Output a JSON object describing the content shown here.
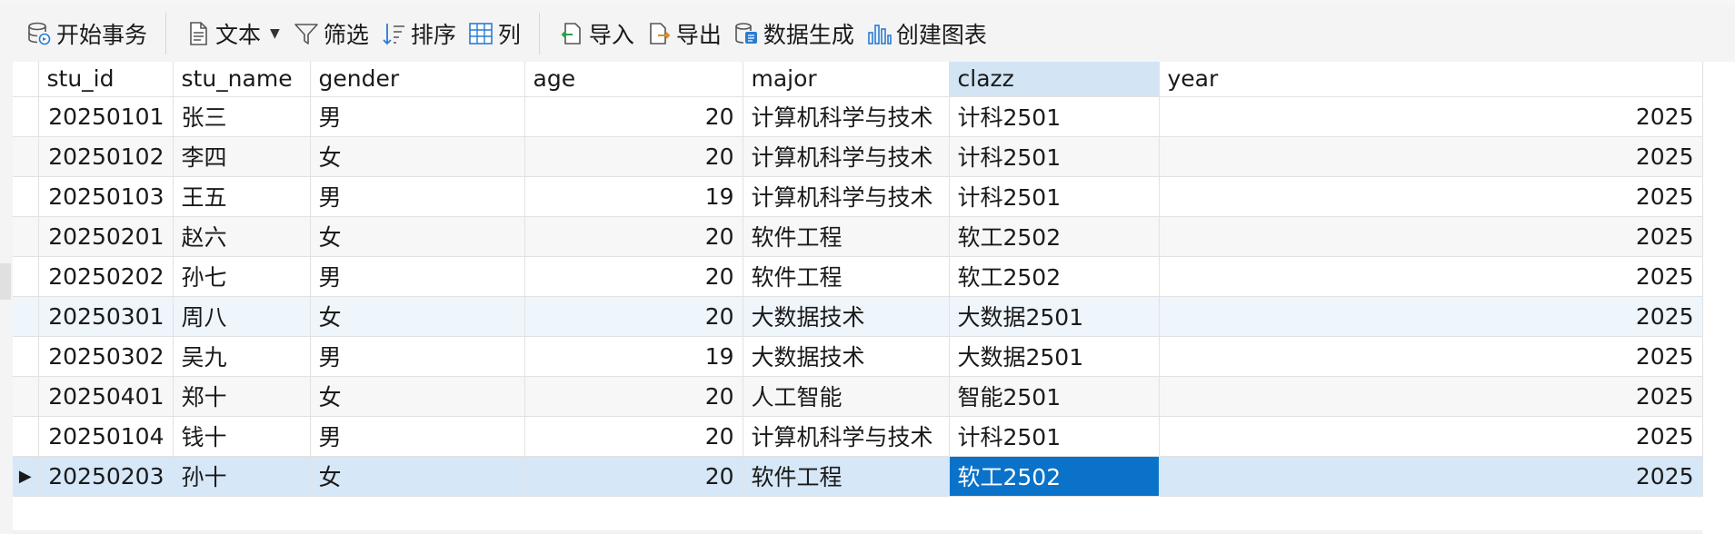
{
  "toolbar": {
    "begin_transaction": "开始事务",
    "text": "文本",
    "filter": "筛选",
    "sort": "排序",
    "columns": "列",
    "import": "导入",
    "export": "导出",
    "data_generate": "数据生成",
    "create_chart": "创建图表"
  },
  "table": {
    "headers": [
      "stu_id",
      "stu_name",
      "gender",
      "age",
      "major",
      "clazz",
      "year"
    ],
    "rows": [
      [
        "20250101",
        "张三",
        "男",
        "20",
        "计算机科学与技术",
        "计科2501",
        "2025"
      ],
      [
        "20250102",
        "李四",
        "女",
        "20",
        "计算机科学与技术",
        "计科2501",
        "2025"
      ],
      [
        "20250103",
        "王五",
        "男",
        "19",
        "计算机科学与技术",
        "计科2501",
        "2025"
      ],
      [
        "20250201",
        "赵六",
        "女",
        "20",
        "软件工程",
        "软工2502",
        "2025"
      ],
      [
        "20250202",
        "孙七",
        "男",
        "20",
        "软件工程",
        "软工2502",
        "2025"
      ],
      [
        "20250301",
        "周八",
        "女",
        "20",
        "大数据技术",
        "大数据2501",
        "2025"
      ],
      [
        "20250302",
        "吴九",
        "男",
        "19",
        "大数据技术",
        "大数据2501",
        "2025"
      ],
      [
        "20250401",
        "郑十",
        "女",
        "20",
        "人工智能",
        "智能2501",
        "2025"
      ],
      [
        "20250104",
        "钱十",
        "男",
        "20",
        "计算机科学与技术",
        "计科2501",
        "2025"
      ],
      [
        "20250203",
        "孙十",
        "女",
        "20",
        "软件工程",
        "软工2502",
        "2025"
      ]
    ],
    "current_row_marker": "▶"
  },
  "colors": {
    "selection": "#0a72c9",
    "selected_header": "#d3e4f4",
    "current_row": "#d6e7f7"
  }
}
